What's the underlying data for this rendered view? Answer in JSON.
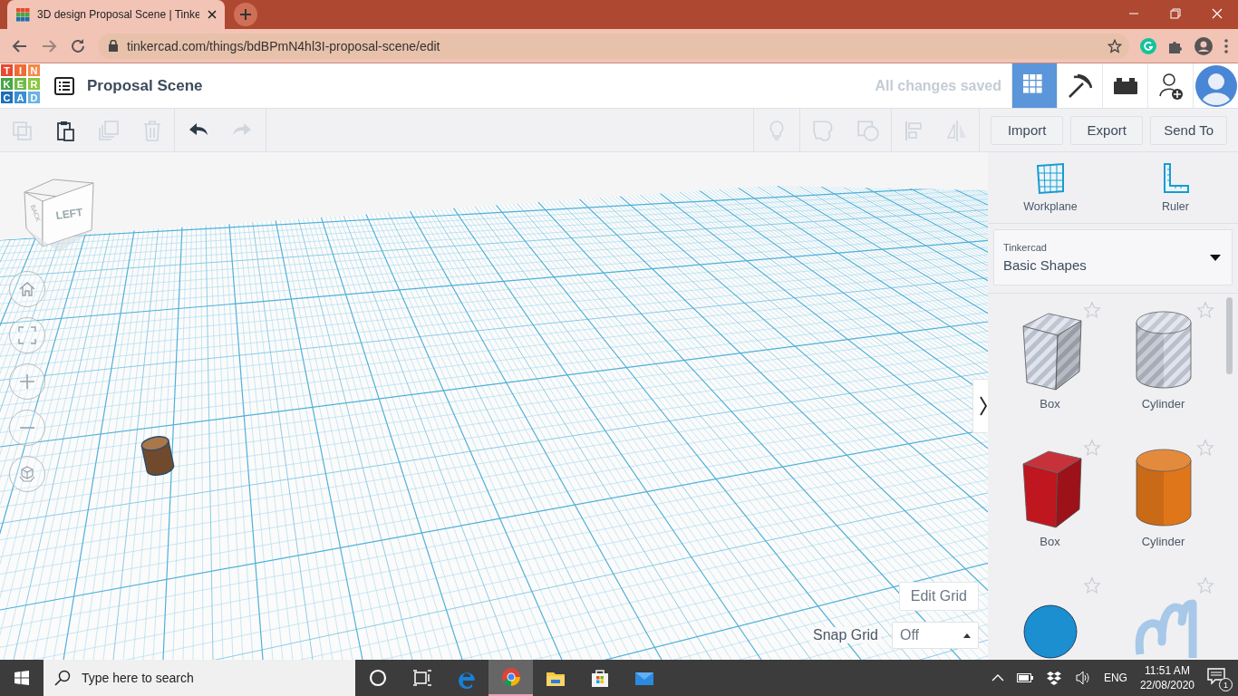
{
  "browser": {
    "tab_title": "3D design Proposal Scene | Tinke",
    "address": "tinkercad.com/things/bdBPmN4hl3I-proposal-scene/edit"
  },
  "header": {
    "logo": [
      {
        "letter": "T",
        "color": "#e8492f"
      },
      {
        "letter": "I",
        "color": "#f26b36"
      },
      {
        "letter": "N",
        "color": "#f5894a"
      },
      {
        "letter": "K",
        "color": "#46a546"
      },
      {
        "letter": "E",
        "color": "#6dbb45"
      },
      {
        "letter": "R",
        "color": "#8dc63f"
      },
      {
        "letter": "C",
        "color": "#1f6fb5"
      },
      {
        "letter": "A",
        "color": "#3a8fd2"
      },
      {
        "letter": "D",
        "color": "#6cb2e4"
      }
    ],
    "title": "Proposal Scene",
    "save_status": "All changes saved",
    "view_modes": [
      {
        "kind": "grid",
        "selected": true
      },
      {
        "kind": "pickaxe",
        "selected": false
      },
      {
        "kind": "bricks",
        "selected": false
      }
    ]
  },
  "toolbar": {
    "edit_tools": [
      {
        "kind": "copy",
        "disabled": true
      },
      {
        "kind": "paste",
        "disabled": false
      },
      {
        "kind": "duplicate",
        "disabled": true
      },
      {
        "kind": "delete",
        "disabled": true
      }
    ],
    "history": [
      {
        "kind": "undo",
        "disabled": false
      },
      {
        "kind": "redo",
        "disabled": true
      }
    ],
    "shape_tools": [
      {
        "kind": "note",
        "disabled": true
      },
      {
        "kind": "group",
        "disabled": true
      },
      {
        "kind": "ungroup",
        "disabled": true
      },
      {
        "kind": "align",
        "disabled": true
      },
      {
        "kind": "mirror",
        "disabled": true
      }
    ],
    "actions": [
      "Import",
      "Export",
      "Send To"
    ]
  },
  "viewport": {
    "view_cube": {
      "front": "LEFT",
      "side": "BACK"
    },
    "objects": [
      {
        "kind": "cylinder"
      }
    ],
    "edit_grid": "Edit Grid",
    "snap_grid": {
      "label": "Snap Grid",
      "value": "Off"
    }
  },
  "sidebar": {
    "tools": [
      {
        "kind": "workplane",
        "label": "Workplane"
      },
      {
        "kind": "ruler",
        "label": "Ruler"
      }
    ],
    "library": {
      "source": "Tinkercad",
      "name": "Basic Shapes"
    },
    "shapes": [
      {
        "kind": "box",
        "label": "Box",
        "hole": true,
        "color": "#b9bfcc",
        "favorite": false
      },
      {
        "kind": "cylinder",
        "label": "Cylinder",
        "hole": true,
        "color": "#b9bfcc",
        "favorite": false
      },
      {
        "kind": "box",
        "label": "Box",
        "hole": false,
        "color": "#c0161f",
        "favorite": false
      },
      {
        "kind": "cylinder",
        "label": "Cylinder",
        "hole": false,
        "color": "#e0761a",
        "favorite": false
      },
      {
        "kind": "sphere",
        "color": "#1b8fcf",
        "favorite": false
      },
      {
        "kind": "scribble",
        "color": "#a7c8e8",
        "favorite": false
      }
    ]
  },
  "taskbar": {
    "search_placeholder": "Type here to search",
    "apps": [
      {
        "kind": "cortana",
        "selected": false
      },
      {
        "kind": "taskview",
        "selected": false
      },
      {
        "kind": "edge",
        "selected": false
      },
      {
        "kind": "chrome",
        "selected": true
      },
      {
        "kind": "explorer",
        "selected": false
      },
      {
        "kind": "store",
        "selected": false
      },
      {
        "kind": "mail",
        "selected": false
      }
    ],
    "tray": {
      "language": "ENG",
      "time": "11:51 AM",
      "date": "22/08/2020",
      "notifications": "1"
    }
  }
}
